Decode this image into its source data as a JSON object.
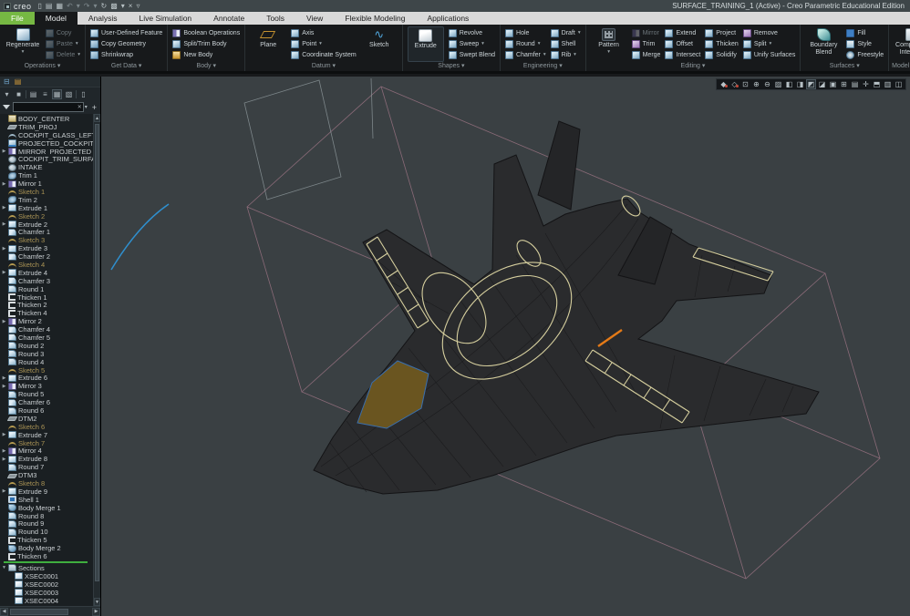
{
  "colors": {
    "titlebar_bg": "#3e4649",
    "tabs_bg": "#d9d9d9",
    "file_tab_green": "#76b843",
    "active_tab_bg": "#17191b",
    "ribbon_bg": "#17191b",
    "panel_bg": "#20262a",
    "tree_bg": "#1a1f22",
    "viewport_bg": "#3a4043",
    "model_fill": "#2a2b2d",
    "model_edge": "#131315",
    "section_curve": "#d6cf9e",
    "datum_pink": "#a5798a",
    "highlight_orange": "#e47a17",
    "spline_blue": "#2f8fce",
    "canopy_olive": "#6a5520",
    "canopy_edge_blue": "#3a6fae",
    "hidden_item": "#ab9455",
    "insert_green": "#3fae3f"
  },
  "title_bar": {
    "app": "creo",
    "title": "SURFACE_TRAINING_1 (Active) - Creo Parametric Educational Edition",
    "icons": [
      {
        "name": "new-file-icon",
        "glyph": "▯"
      },
      {
        "name": "open-icon",
        "glyph": "▤"
      },
      {
        "name": "save-icon",
        "glyph": "▦"
      },
      {
        "name": "undo-icon",
        "glyph": "↶",
        "dim": true
      },
      {
        "name": "undo-arrow-icon",
        "glyph": "▾",
        "dim": true
      },
      {
        "name": "redo-icon",
        "glyph": "↷",
        "dim": true
      },
      {
        "name": "redo-arrow-icon",
        "glyph": "▾",
        "dim": true
      },
      {
        "name": "regenerate-quick-icon",
        "glyph": "↻"
      },
      {
        "name": "window-display-icon",
        "glyph": "▩"
      },
      {
        "name": "display-arrow-icon",
        "glyph": "▾"
      },
      {
        "name": "close-window-icon",
        "glyph": "×"
      },
      {
        "name": "customize-quick-access-icon",
        "glyph": "▿"
      }
    ]
  },
  "tabs": [
    {
      "label": "File",
      "kind": "file"
    },
    {
      "label": "Model",
      "kind": "active"
    },
    {
      "label": "Analysis",
      "kind": "normal"
    },
    {
      "label": "Live Simulation",
      "kind": "normal"
    },
    {
      "label": "Annotate",
      "kind": "normal"
    },
    {
      "label": "Tools",
      "kind": "normal"
    },
    {
      "label": "View",
      "kind": "normal"
    },
    {
      "label": "Flexible Modeling",
      "kind": "normal"
    },
    {
      "label": "Applications",
      "kind": "normal"
    }
  ],
  "ribbon": {
    "groups": [
      {
        "label": "Operations ▾",
        "big": [
          {
            "label": "Regenerate",
            "icon": "regenerate-icon",
            "arrow": true
          }
        ],
        "cols": [
          [
            {
              "label": "Copy",
              "icon": "copy-icon",
              "disabled": true
            },
            {
              "label": "Paste",
              "icon": "paste-icon",
              "arrow": true,
              "disabled": true
            },
            {
              "label": "Delete",
              "icon": "delete-icon",
              "arrow": true,
              "disabled": true
            }
          ]
        ]
      },
      {
        "label": "Get Data ▾",
        "cols": [
          [
            {
              "label": "User-Defined Feature",
              "icon": "user-defined-feature-icon"
            },
            {
              "label": "Copy Geometry",
              "icon": "copy-geometry-icon"
            },
            {
              "label": "Shrinkwrap",
              "icon": "shrinkwrap-icon"
            }
          ]
        ]
      },
      {
        "label": "Body ▾",
        "cols": [
          [
            {
              "label": "Boolean Operations",
              "icon": "boolean-operations-icon"
            },
            {
              "label": "Split/Trim Body",
              "icon": "split-trim-body-icon"
            },
            {
              "label": "New Body",
              "icon": "new-body-icon"
            }
          ]
        ]
      },
      {
        "label": "Datum ▾",
        "big": [
          {
            "label": "Plane",
            "icon": "plane-icon"
          }
        ],
        "cols": [
          [
            {
              "label": "Axis",
              "icon": "axis-icon"
            },
            {
              "label": "Point",
              "icon": "point-icon",
              "arrow": true
            },
            {
              "label": "Coordinate System",
              "icon": "coordinate-system-icon"
            }
          ]
        ],
        "big_after": [
          {
            "label": "Sketch",
            "icon": "sketch-icon"
          }
        ]
      },
      {
        "label": "Shapes ▾",
        "big": [
          {
            "label": "Extrude",
            "icon": "extrude-icon",
            "highlight": true
          }
        ],
        "cols": [
          [
            {
              "label": "Revolve",
              "icon": "revolve-icon"
            },
            {
              "label": "Sweep",
              "icon": "sweep-icon",
              "arrow": true
            },
            {
              "label": "Swept Blend",
              "icon": "swept-blend-icon"
            }
          ]
        ]
      },
      {
        "label": "Engineering ▾",
        "cols": [
          [
            {
              "label": "Hole",
              "icon": "hole-icon"
            },
            {
              "label": "Round",
              "icon": "round-icon",
              "arrow": true
            },
            {
              "label": "Chamfer",
              "icon": "chamfer-icon",
              "arrow": true
            }
          ],
          [
            {
              "label": "Draft",
              "icon": "draft-icon",
              "arrow": true
            },
            {
              "label": "Shell",
              "icon": "shell-icon"
            },
            {
              "label": "Rib",
              "icon": "rib-icon",
              "arrow": true
            }
          ]
        ]
      },
      {
        "label": "Editing ▾",
        "big": [
          {
            "label": "Pattern",
            "icon": "pattern-icon",
            "arrow": true
          }
        ],
        "cols": [
          [
            {
              "label": "Mirror",
              "icon": "mirror-icon",
              "disabled": true
            },
            {
              "label": "Trim",
              "icon": "trim-icon"
            },
            {
              "label": "Merge",
              "icon": "merge-icon"
            }
          ],
          [
            {
              "label": "Extend",
              "icon": "extend-icon"
            },
            {
              "label": "Offset",
              "icon": "offset-icon"
            },
            {
              "label": "Intersect",
              "icon": "intersect-icon"
            }
          ],
          [
            {
              "label": "Project",
              "icon": "project-icon"
            },
            {
              "label": "Thicken",
              "icon": "thicken-icon"
            },
            {
              "label": "Solidify",
              "icon": "solidify-icon"
            }
          ],
          [
            {
              "label": "Remove",
              "icon": "remove-icon"
            },
            {
              "label": "Split",
              "icon": "split-icon",
              "arrow": true
            },
            {
              "label": "Unify Surfaces",
              "icon": "unify-surfaces-icon"
            }
          ]
        ]
      },
      {
        "label": "Surfaces ▾",
        "big": [
          {
            "label": "Boundary Blend",
            "icon": "boundary-blend-icon"
          }
        ],
        "cols": [
          [
            {
              "label": "Fill",
              "icon": "fill-icon"
            },
            {
              "label": "Style",
              "icon": "style-icon"
            },
            {
              "label": "Freestyle",
              "icon": "freestyle-icon"
            }
          ]
        ]
      },
      {
        "label": "Model Intent ▾",
        "big": [
          {
            "label": "Component Interface",
            "icon": "component-interface-icon"
          }
        ]
      }
    ]
  },
  "navigator": {
    "head_icons": [
      {
        "name": "model-tree-tab-icon",
        "glyph": "⊟",
        "cls": "c-blue"
      },
      {
        "name": "folder-browser-tab-icon",
        "glyph": "▤",
        "cls": "c-orange"
      }
    ],
    "toolbar": [
      {
        "name": "tree-options-arrow-icon",
        "glyph": "▾",
        "cls": "c-white"
      },
      {
        "name": "model-tree-icon",
        "glyph": "■",
        "cls": "c-green"
      },
      {
        "name": "sep"
      },
      {
        "name": "design-tree-icon",
        "glyph": "▤",
        "cls": "c-blue"
      },
      {
        "name": "list-view-icon",
        "glyph": "≡",
        "cls": "c-white"
      },
      {
        "name": "columns-view-icon",
        "glyph": "▦",
        "cls": "c-white",
        "active": true
      },
      {
        "name": "layer-tree-icon",
        "glyph": "▧",
        "cls": "c-orange"
      },
      {
        "name": "sep"
      },
      {
        "name": "detail-view-icon",
        "glyph": "▯",
        "cls": "c-white"
      }
    ],
    "filter": {
      "value": "",
      "clear_glyph": "✕",
      "dropdown_glyph": "▾",
      "add_glyph": "+"
    }
  },
  "tree": {
    "items": [
      {
        "label": "BODY_CENTER",
        "type": "body"
      },
      {
        "label": "TRIM_PROJ",
        "type": "dtm"
      },
      {
        "label": "COCKPIT_GLASS_LEFT",
        "type": "sketchb"
      },
      {
        "label": "PROJECTED_COCKPIT_GLASS_L",
        "type": "proj"
      },
      {
        "label": "MIRROR_PROJECTED_COCKPIT",
        "type": "mirror",
        "exp": true
      },
      {
        "label": "COCKPIT_TRIM_SURFACE",
        "type": "surf"
      },
      {
        "label": "INTAKE",
        "type": "surf"
      },
      {
        "label": "Trim 1",
        "type": "trim"
      },
      {
        "label": "Mirror 1",
        "type": "mirror",
        "exp": true
      },
      {
        "label": "Sketch 1",
        "type": "sketch",
        "hid": true
      },
      {
        "label": "Trim 2",
        "type": "trim"
      },
      {
        "label": "Extrude 1",
        "type": "extrude",
        "exp": true
      },
      {
        "label": "Sketch 2",
        "type": "sketch",
        "hid": true
      },
      {
        "label": "Extrude 2",
        "type": "extrude",
        "exp": true
      },
      {
        "label": "Chamfer 1",
        "type": "chamfer"
      },
      {
        "label": "Sketch 3",
        "type": "sketch",
        "hid": true
      },
      {
        "label": "Extrude 3",
        "type": "extrude",
        "exp": true
      },
      {
        "label": "Chamfer 2",
        "type": "chamfer"
      },
      {
        "label": "Sketch 4",
        "type": "sketch",
        "hid": true
      },
      {
        "label": "Extrude 4",
        "type": "extrude",
        "exp": true
      },
      {
        "label": "Chamfer 3",
        "type": "chamfer"
      },
      {
        "label": "Round 1",
        "type": "round"
      },
      {
        "label": "Thicken 1",
        "type": "thicken"
      },
      {
        "label": "Thicken 2",
        "type": "thicken"
      },
      {
        "label": "Thicken 4",
        "type": "thicken"
      },
      {
        "label": "Mirror 2",
        "type": "mirror",
        "exp": true
      },
      {
        "label": "Chamfer 4",
        "type": "chamfer"
      },
      {
        "label": "Chamfer 5",
        "type": "chamfer"
      },
      {
        "label": "Round 2",
        "type": "round"
      },
      {
        "label": "Round 3",
        "type": "round"
      },
      {
        "label": "Round 4",
        "type": "round"
      },
      {
        "label": "Sketch 5",
        "type": "sketch",
        "hid": true
      },
      {
        "label": "Extrude 6",
        "type": "extrude",
        "exp": true
      },
      {
        "label": "Mirror 3",
        "type": "mirror",
        "exp": true
      },
      {
        "label": "Round 5",
        "type": "round"
      },
      {
        "label": "Chamfer 6",
        "type": "chamfer"
      },
      {
        "label": "Round 6",
        "type": "round"
      },
      {
        "label": "DTM2",
        "type": "dtm"
      },
      {
        "label": "Sketch 6",
        "type": "sketch",
        "hid": true
      },
      {
        "label": "Extrude 7",
        "type": "extrude",
        "exp": true
      },
      {
        "label": "Sketch 7",
        "type": "sketch",
        "hid": true
      },
      {
        "label": "Mirror 4",
        "type": "mirror",
        "exp": true
      },
      {
        "label": "Extrude 8",
        "type": "extrude",
        "exp": true
      },
      {
        "label": "Round 7",
        "type": "round"
      },
      {
        "label": "DTM3",
        "type": "dtm"
      },
      {
        "label": "Sketch 8",
        "type": "sketch",
        "hid": true
      },
      {
        "label": "Extrude 9",
        "type": "extrude",
        "exp": true
      },
      {
        "label": "Shell 1",
        "type": "shell"
      },
      {
        "label": "Body Merge 1",
        "type": "merge"
      },
      {
        "label": "Round 8",
        "type": "round"
      },
      {
        "label": "Round 9",
        "type": "round"
      },
      {
        "label": "Round 10",
        "type": "round"
      },
      {
        "label": "Thicken 5",
        "type": "thicken"
      },
      {
        "label": "Body Merge 2",
        "type": "merge"
      },
      {
        "label": "Thicken 6",
        "type": "thicken"
      }
    ],
    "sections": {
      "label": "Sections",
      "items": [
        "XSEC0001",
        "XSEC0002",
        "XSEC0003",
        "XSEC0004"
      ]
    }
  },
  "graphics_toolbar": [
    {
      "name": "drag-mode-icon",
      "glyph": "◆",
      "dot": true
    },
    {
      "name": "orient-mode-icon",
      "glyph": "◇",
      "dot": true
    },
    {
      "name": "refit-icon",
      "glyph": "⊡"
    },
    {
      "name": "zoom-in-icon",
      "glyph": "⊕"
    },
    {
      "name": "zoom-out-icon",
      "glyph": "⊖"
    },
    {
      "name": "repaint-icon",
      "glyph": "▨"
    },
    {
      "name": "shading-with-edges-icon",
      "glyph": "◧"
    },
    {
      "name": "shading-icon",
      "glyph": "◨"
    },
    {
      "name": "no-hidden-icon",
      "glyph": "◩",
      "active": true
    },
    {
      "name": "wireframe-icon",
      "glyph": "◪"
    },
    {
      "name": "display-style-icon",
      "glyph": "▣"
    },
    {
      "name": "datum-display-filters-icon",
      "glyph": "⊞"
    },
    {
      "name": "annotation-display-icon",
      "glyph": "▤"
    },
    {
      "name": "spin-center-icon",
      "glyph": "✛"
    },
    {
      "name": "perspective-icon",
      "glyph": "⬒"
    },
    {
      "name": "saved-orientations-icon",
      "glyph": "▥"
    },
    {
      "name": "view-manager-icon",
      "glyph": "◫"
    }
  ]
}
